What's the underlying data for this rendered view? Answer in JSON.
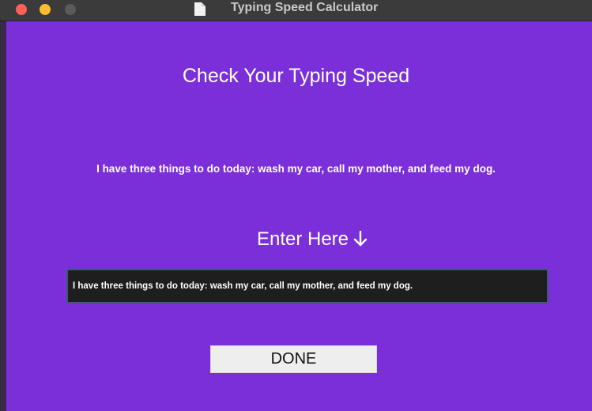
{
  "window": {
    "title": "Typing Speed Calculator",
    "background_color": "#7b2fd9",
    "titlebar_color": "#3b3b3b",
    "controls": [
      "close-button",
      "minimize-button",
      "zoom-button"
    ]
  },
  "main": {
    "heading": "Check Your Typing Speed",
    "sample_text": "I have three things to do today: wash my car, call my mother, and feed my dog.",
    "enter_label": "Enter Here",
    "enter_icon": "arrow-down-icon",
    "entry_value": "I have three things to do today: wash my car, call my mother, and feed my dog.",
    "done_label": "DONE"
  }
}
